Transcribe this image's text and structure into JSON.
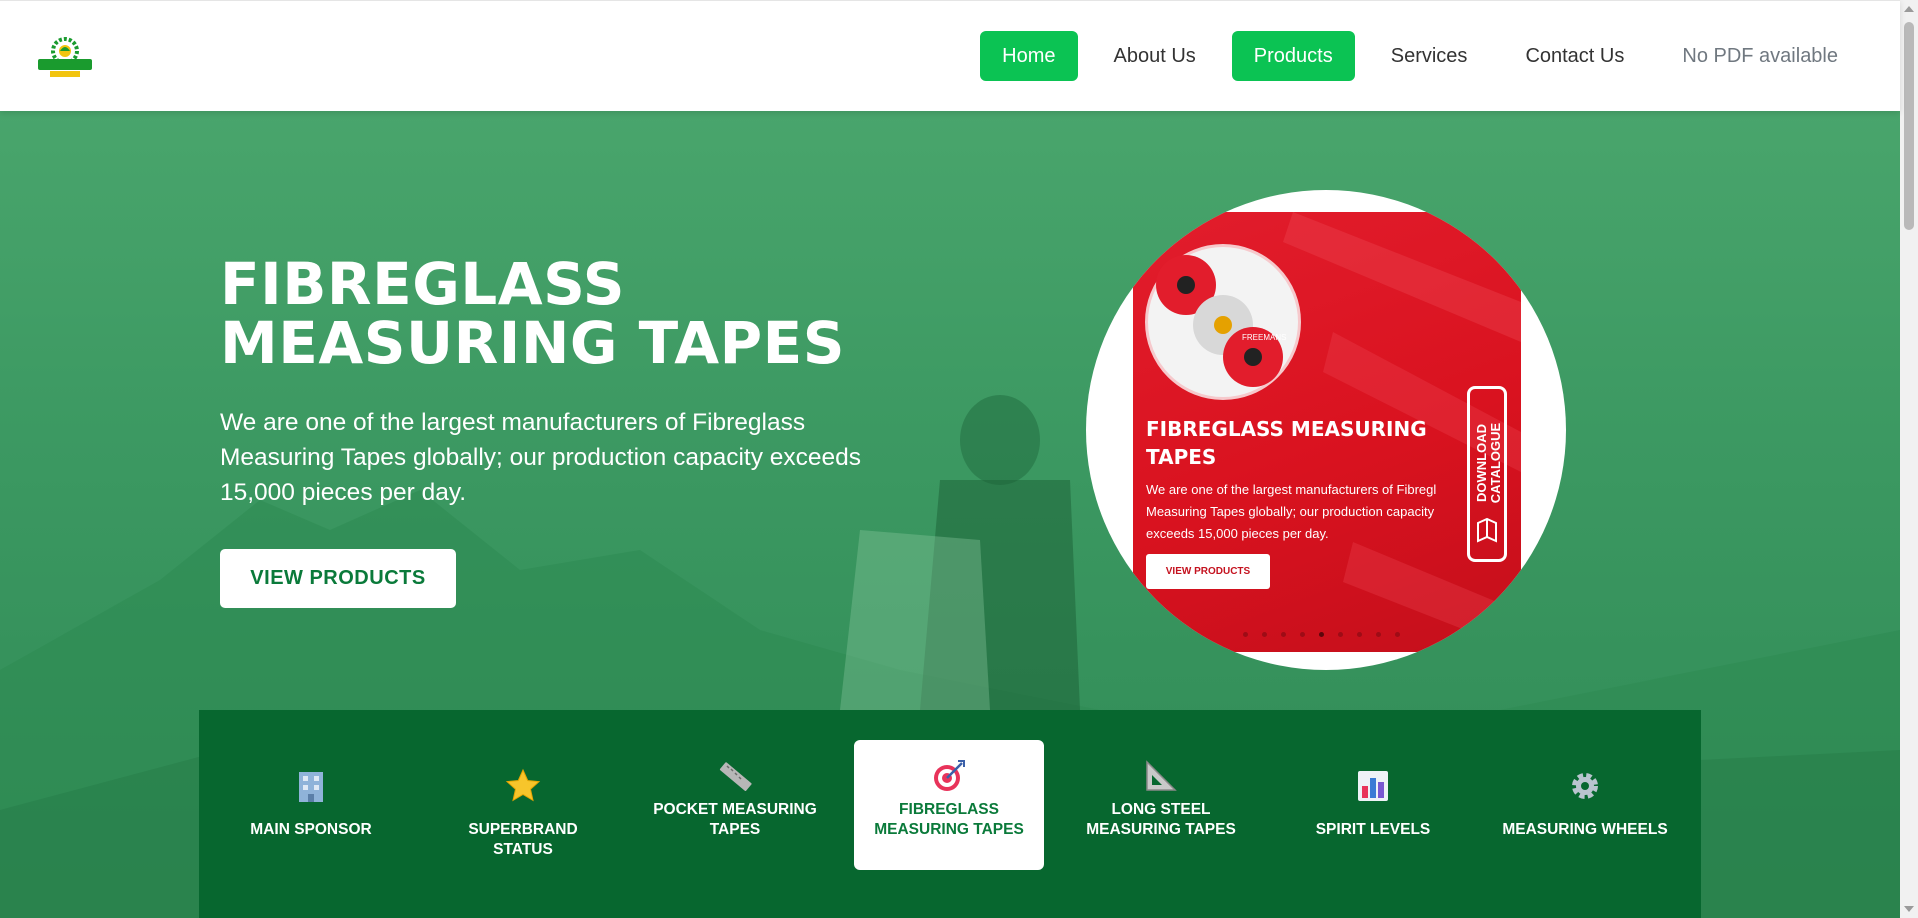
{
  "header": {
    "logo_alt": "GREEN HOUSE SAFETY",
    "nav": [
      {
        "label": "Home",
        "active": true
      },
      {
        "label": "About Us",
        "active": false
      },
      {
        "label": "Products",
        "active": true
      },
      {
        "label": "Services",
        "active": false
      },
      {
        "label": "Contact Us",
        "active": false
      },
      {
        "label": "No PDF available",
        "active": false
      }
    ]
  },
  "hero": {
    "title_line1": "FIBREGLASS",
    "title_line2": "MEASURING TAPES",
    "description": "We are one of the largest manufacturers of Fibreglass Measuring Tapes globally; our production capacity exceeds 15,000 pieces per day.",
    "button_label": "VIEW PRODUCTS",
    "card": {
      "title": "FIBREGLASS MEASURING TAPES",
      "desc_line1": "We are one of the largest manufacturers of Fibregl",
      "desc_line2": "Measuring Tapes globally; our production capacity",
      "desc_line3": "exceeds 15,000 pieces per day.",
      "button_label": "VIEW PRODUCTS",
      "side_tab_line1": "DOWNLOAD",
      "side_tab_line2": "CATALOGUE",
      "brand_on_tape": "FREEMANS"
    }
  },
  "categories": [
    {
      "label": "MAIN SPONSOR",
      "icon": "building-icon",
      "active": false
    },
    {
      "label": "SUPERBRAND STATUS",
      "icon": "star-icon",
      "active": false
    },
    {
      "label": "POCKET MEASURING TAPES",
      "icon": "ruler-icon",
      "active": false
    },
    {
      "label": "FIBREGLASS MEASURING TAPES",
      "icon": "target-icon",
      "active": true
    },
    {
      "label": "LONG STEEL MEASURING TAPES",
      "icon": "triangle-ruler-icon",
      "active": false
    },
    {
      "label": "SPIRIT LEVELS",
      "icon": "bar-chart-icon",
      "active": false
    },
    {
      "label": "MEASURING WHEELS",
      "icon": "gear-icon",
      "active": false
    }
  ],
  "colors": {
    "brand_green": "#0bc353",
    "dark_green": "#07672f",
    "card_red": "#d9121f"
  }
}
